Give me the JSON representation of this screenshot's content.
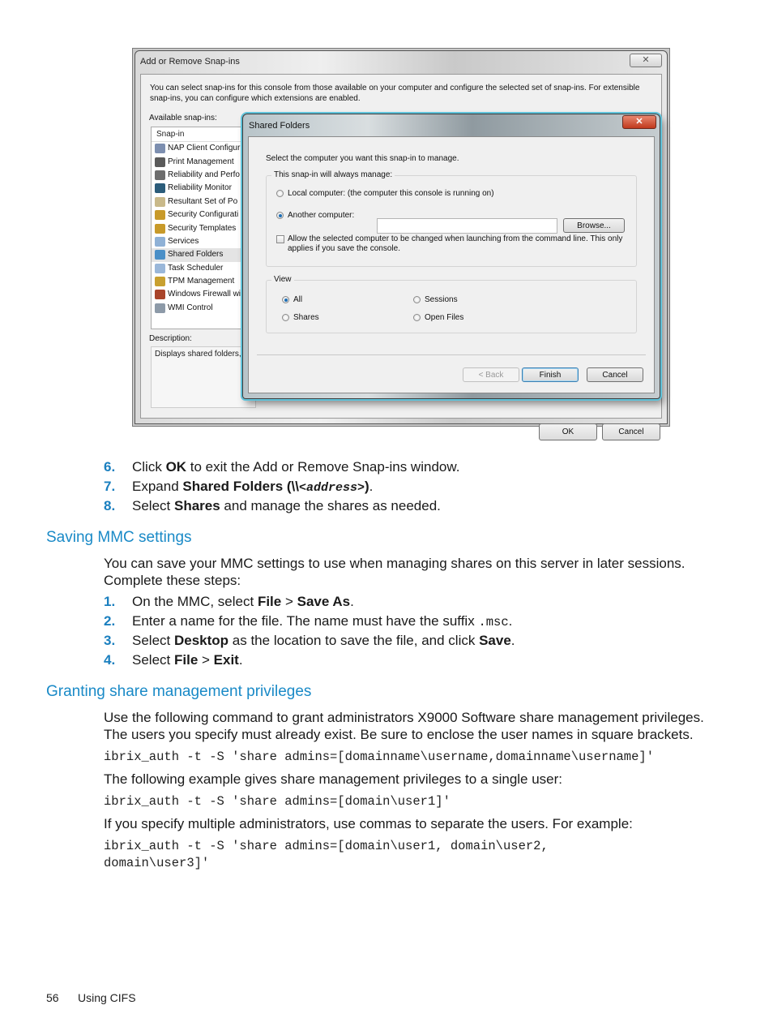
{
  "figure": {
    "outer_dialog": {
      "title": "Add or Remove Snap-ins",
      "close_glyph": "✕",
      "intro": "You can select snap-ins for this console from those available on your computer and configure the selected set of snap-ins. For extensible snap-ins, you can configure which extensions are enabled.",
      "available_label": "Available snap-ins:",
      "list_header": "Snap-in",
      "snapins": [
        {
          "label": "NAP Client Configur",
          "icon": "nap-client-icon",
          "color": "#7d8fb0"
        },
        {
          "label": "Print Management",
          "icon": "print-management-icon",
          "color": "#5a5a5a"
        },
        {
          "label": "Reliability and Perfo",
          "icon": "reliability-perf-icon",
          "color": "#6d6d6d"
        },
        {
          "label": "Reliability Monitor",
          "icon": "reliability-monitor-icon",
          "color": "#2b5c7a"
        },
        {
          "label": "Resultant Set of Po",
          "icon": "resultant-set-icon",
          "color": "#c9b98a"
        },
        {
          "label": "Security Configurati",
          "icon": "security-config-icon",
          "color": "#c89a2a"
        },
        {
          "label": "Security Templates",
          "icon": "security-templates-icon",
          "color": "#c89a2a"
        },
        {
          "label": "Services",
          "icon": "services-icon",
          "color": "#8fb1d6"
        },
        {
          "label": "Shared Folders",
          "icon": "shared-folders-icon",
          "color": "#4a8fc7",
          "selected": true
        },
        {
          "label": "Task Scheduler",
          "icon": "task-scheduler-icon",
          "color": "#9ab7d9"
        },
        {
          "label": "TPM Management",
          "icon": "tpm-management-icon",
          "color": "#c8a030"
        },
        {
          "label": "Windows Firewall wi",
          "icon": "windows-firewall-icon",
          "color": "#a9442a"
        },
        {
          "label": "WMI Control",
          "icon": "wmi-control-icon",
          "color": "#8d9aa8"
        }
      ],
      "description_label": "Description:",
      "description_text": "Displays shared folders,",
      "ok_label": "OK",
      "cancel_label": "Cancel"
    },
    "inner_dialog": {
      "title": "Shared Folders",
      "close_glyph": "✕",
      "prompt": "Select the computer you want this snap-in to manage.",
      "manage_group_label": "This snap-in will always manage:",
      "local_computer_label": "Local computer:  (the computer this console is running on)",
      "another_computer_label": "Another computer:",
      "another_computer_value": "",
      "browse_label": "Browse...",
      "allow_change_label": "Allow the selected computer to be changed when launching from the command line.  This only applies if you save the console.",
      "allow_change_checked": false,
      "selected_target": "Another computer",
      "view_group_label": "View",
      "view_options": [
        "All",
        "Sessions",
        "Shares",
        "Open Files"
      ],
      "view_selected": "All",
      "back_label": "< Back",
      "finish_label": "Finish",
      "cancel_label": "Cancel"
    }
  },
  "steps_continued": [
    {
      "num": "6.",
      "pre": "Click ",
      "bold": "OK",
      "post": " to exit the Add or Remove Snap-ins window."
    },
    {
      "num": "7.",
      "pre": "Expand ",
      "bold": "Shared Folders (\\\\",
      "code": "<address>",
      "bold2": ")",
      "post": "."
    },
    {
      "num": "8.",
      "pre": "Select ",
      "bold": "Shares",
      "post": " and manage the shares as needed."
    }
  ],
  "section_saving": {
    "heading": "Saving MMC settings",
    "intro": "You can save your MMC settings to use when managing shares on this server in later sessions. Complete these steps:",
    "steps": [
      {
        "num": "1.",
        "parts": [
          "On the MMC, select ",
          "File",
          " > ",
          "Save As",
          "."
        ]
      },
      {
        "num": "2.",
        "pre": "Enter a name for the file. The name must have the suffix ",
        "code": ".msc",
        "post": "."
      },
      {
        "num": "3.",
        "parts": [
          "Select ",
          "Desktop",
          " as the location to save the file, and click ",
          "Save",
          "."
        ]
      },
      {
        "num": "4.",
        "parts": [
          "Select ",
          "File",
          " > ",
          "Exit",
          "."
        ]
      }
    ]
  },
  "section_granting": {
    "heading": "Granting share management privileges",
    "intro": "Use the following command to grant administrators X9000 Software share management privileges. The users you specify must already exist. Be sure to enclose the user names in square brackets.",
    "command_general": "ibrix_auth -t -S 'share admins=[domainname\\username,domainname\\username]'",
    "example_single_intro": "The following example gives share management privileges to a single user:",
    "command_single": "ibrix_auth -t -S 'share admins=[domain\\user1]'",
    "example_multi_intro": "If you specify multiple administrators, use commas to separate the users. For example:",
    "command_multi": "ibrix_auth -t -S 'share admins=[domain\\user1, domain\\user2,\ndomain\\user3]'"
  },
  "footer": {
    "page_number": "56",
    "chapter": "Using CIFS"
  },
  "colors": {
    "heading": "#1a8ac7",
    "step_number": "#1a7fbf"
  }
}
